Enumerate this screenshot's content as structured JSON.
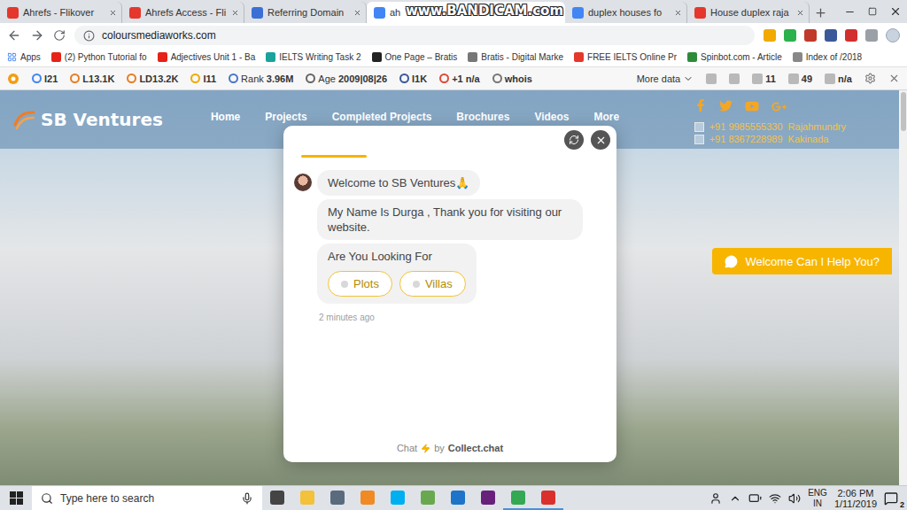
{
  "browser": {
    "tabs": [
      {
        "label": "Ahrefs - Flikover",
        "selected": false
      },
      {
        "label": "Ahrefs Access - Fli",
        "selected": false
      },
      {
        "label": "Referring Domain",
        "selected": false
      },
      {
        "label": "ah",
        "selected": true
      },
      {
        "label": "duplex houses fo",
        "selected": false
      },
      {
        "label": "House duplex raja",
        "selected": false
      }
    ],
    "url": "coloursmediaworks.com",
    "apps_label": "Apps",
    "bookmarks": [
      "(2) Python Tutorial fo",
      "Adjectives Unit 1 - Ba",
      "IELTS Writing Task 2",
      "One Page – Bratis",
      "Bratis - Digital Marke",
      "FREE IELTS Online Pr",
      "Spinbot.com - Article",
      "Index of /2018"
    ]
  },
  "watermark": "www.BANDICAM.com",
  "seo_toolbar": {
    "metrics": [
      {
        "label": "",
        "value": "I21"
      },
      {
        "label": "",
        "value": "L13.1K"
      },
      {
        "label": "",
        "value": "LD13.2K"
      },
      {
        "label": "",
        "value": "I11"
      },
      {
        "label": "Rank",
        "value": "3.96M"
      },
      {
        "label": "Age",
        "value": "2009|08|26"
      },
      {
        "label": "",
        "value": "I1K"
      },
      {
        "label": "",
        "value": "+1 n/a"
      },
      {
        "label": "",
        "value": "whois"
      }
    ],
    "more": "More data",
    "counters": [
      "11",
      "49",
      "n/a"
    ]
  },
  "site": {
    "logo": "SB Ventures",
    "nav": [
      "Home",
      "Projects",
      "Completed Projects",
      "Brochures",
      "Videos",
      "More"
    ],
    "phones": [
      {
        "number": "+91 9985555330",
        "city": "Rajahmundry"
      },
      {
        "number": "+91 8367228989",
        "city": "Kakinada"
      }
    ],
    "help_button": "Welcome Can I Help You?"
  },
  "chat": {
    "progress": {
      "level": 0.22
    },
    "messages": [
      "Welcome to SB Ventures🙏",
      "My Name Is Durga , Thank you for visiting our website."
    ],
    "question": "Are You Looking For",
    "options": [
      "Plots",
      "Villas"
    ],
    "time": "2 minutes ago",
    "footer": {
      "label": "Chat",
      "by": "by",
      "brand": "Collect.chat"
    }
  },
  "taskbar": {
    "search_placeholder": "Type here to search",
    "apps": [
      {
        "running": false
      },
      {
        "running": false
      },
      {
        "running": false
      },
      {
        "running": false
      },
      {
        "running": false
      },
      {
        "running": false
      },
      {
        "running": false
      },
      {
        "running": false
      },
      {
        "running": true
      },
      {
        "running": true
      }
    ],
    "language": "ENG",
    "region": "IN",
    "time": "2:06 PM",
    "date": "1/11/2019",
    "notifications": "2"
  }
}
